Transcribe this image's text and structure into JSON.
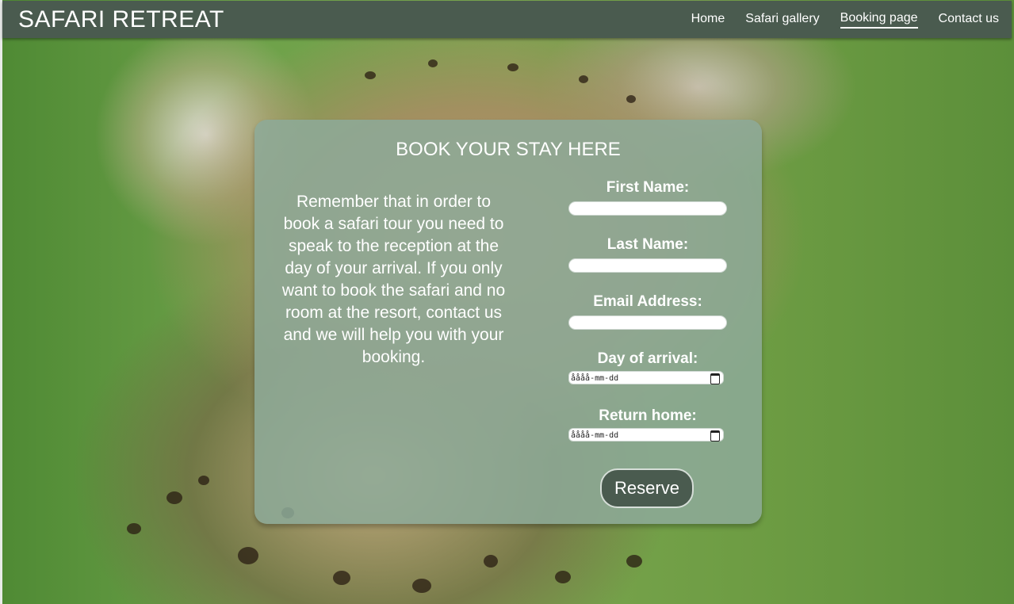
{
  "brand": "SAFARI RETREAT",
  "nav": {
    "items": [
      {
        "label": "Home"
      },
      {
        "label": "Safari gallery"
      },
      {
        "label": "Booking page"
      },
      {
        "label": "Contact us"
      }
    ],
    "active": "Booking page"
  },
  "booking": {
    "title": "BOOK YOUR STAY HERE",
    "info": "Remember that in order to book a safari tour you need to speak to the reception at the day of your arrival. If you only want to book the safari and no room at the resort, contact us and we will help you with your booking.",
    "fields": {
      "first_name": {
        "label": "First Name:",
        "value": ""
      },
      "last_name": {
        "label": "Last Name:",
        "value": ""
      },
      "email": {
        "label": "Email Address:",
        "value": ""
      },
      "arrival": {
        "label": "Day of arrival:",
        "placeholder": "åååå-mm-dd"
      },
      "return": {
        "label": "Return home:",
        "placeholder": "åååå-mm-dd"
      }
    },
    "submit_label": "Reserve"
  },
  "colors": {
    "navbar": "#4a5b4f",
    "card": "#8daa98",
    "button": "#4a5b4f",
    "text": "#ffffff"
  },
  "icons": [
    "calendar-icon"
  ]
}
